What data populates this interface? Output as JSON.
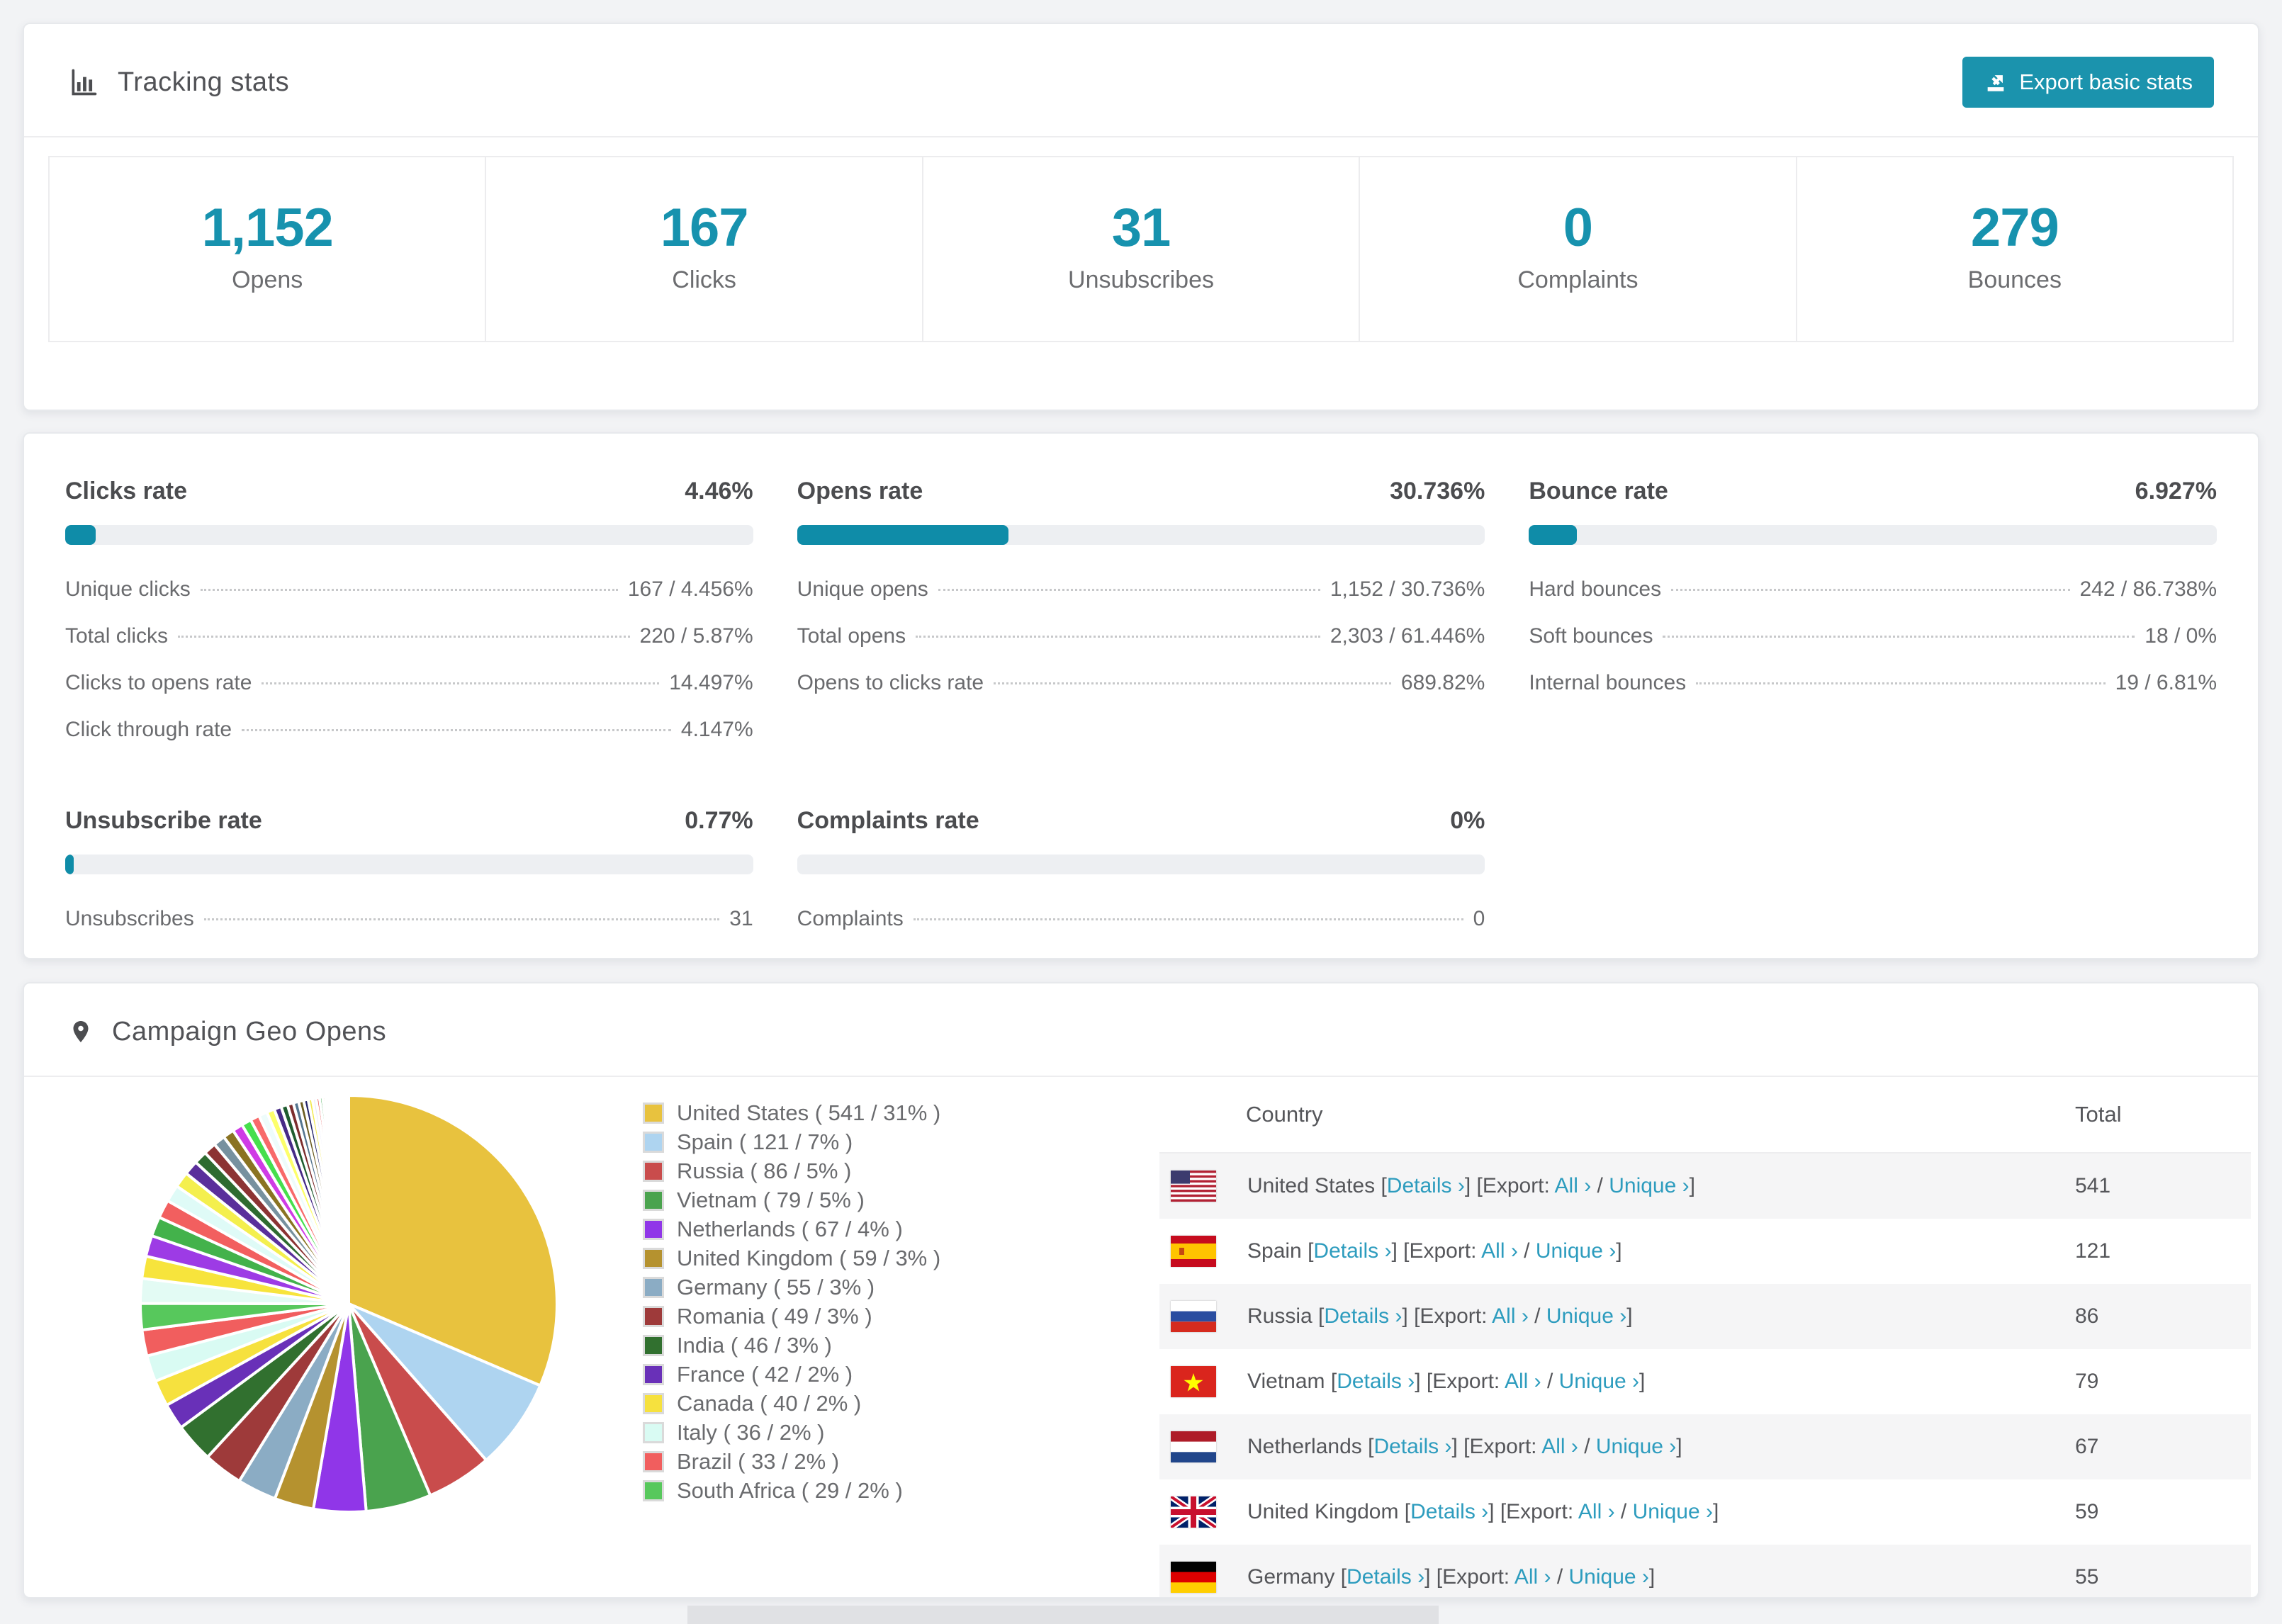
{
  "accent": "#1792ae",
  "tracking": {
    "title": "Tracking stats",
    "export_button": "Export basic stats",
    "stats": [
      {
        "value": "1,152",
        "label": "Opens"
      },
      {
        "value": "167",
        "label": "Clicks"
      },
      {
        "value": "31",
        "label": "Unsubscribes"
      },
      {
        "value": "0",
        "label": "Complaints"
      },
      {
        "value": "279",
        "label": "Bounces"
      }
    ]
  },
  "rates": [
    {
      "title": "Clicks rate",
      "value": "4.46%",
      "percent": 4.46,
      "rows": [
        {
          "label": "Unique clicks",
          "value": "167 / 4.456%"
        },
        {
          "label": "Total clicks",
          "value": "220 / 5.87%"
        },
        {
          "label": "Clicks to opens rate",
          "value": "14.497%"
        },
        {
          "label": "Click through rate",
          "value": "4.147%"
        }
      ]
    },
    {
      "title": "Opens rate",
      "value": "30.736%",
      "percent": 30.736,
      "rows": [
        {
          "label": "Unique opens",
          "value": "1,152 / 30.736%"
        },
        {
          "label": "Total opens",
          "value": "2,303 / 61.446%"
        },
        {
          "label": "Opens to clicks rate",
          "value": "689.82%"
        }
      ]
    },
    {
      "title": "Bounce rate",
      "value": "6.927%",
      "percent": 6.927,
      "rows": [
        {
          "label": "Hard bounces",
          "value": "242 / 86.738%"
        },
        {
          "label": "Soft bounces",
          "value": "18 / 0%"
        },
        {
          "label": "Internal bounces",
          "value": "19 / 6.81%"
        }
      ]
    },
    {
      "title": "Unsubscribe rate",
      "value": "0.77%",
      "percent": 0.77,
      "rows": [
        {
          "label": "Unsubscribes",
          "value": "31"
        }
      ]
    },
    {
      "title": "Complaints rate",
      "value": "0%",
      "percent": 0,
      "rows": [
        {
          "label": "Complaints",
          "value": "0"
        }
      ]
    }
  ],
  "geo": {
    "title": "Campaign Geo Opens",
    "chart_data": {
      "type": "pie",
      "title": "Campaign Geo Opens",
      "labels": [
        "United States",
        "Spain",
        "Russia",
        "Vietnam",
        "Netherlands",
        "United Kingdom",
        "Germany",
        "Romania",
        "India",
        "France",
        "Canada",
        "Italy",
        "Brazil",
        "South Africa"
      ],
      "values": [
        541,
        121,
        86,
        79,
        67,
        59,
        55,
        49,
        46,
        42,
        40,
        36,
        33,
        29
      ],
      "percents": [
        31,
        7,
        5,
        5,
        4,
        3,
        3,
        3,
        3,
        2,
        2,
        2,
        2,
        2
      ],
      "colors": [
        "#e8c23e",
        "#aed4f0",
        "#c94c4c",
        "#4aa34e",
        "#9036e8",
        "#b5922f",
        "#8bacc4",
        "#9e3a3a",
        "#31702f",
        "#6930b8",
        "#f6e13e",
        "#d9fbf3",
        "#f15e5e",
        "#57c85c"
      ],
      "legend_position": "right",
      "others": {
        "values": [
          1.9,
          1.7,
          1.6,
          1.5,
          1.4,
          1.3,
          1.2,
          1.1,
          1.0,
          0.95,
          0.9,
          0.85,
          0.8,
          0.75,
          0.7,
          0.65,
          0.6,
          0.55,
          0.5,
          0.46,
          0.42,
          0.38,
          0.35,
          0.32,
          0.29,
          0.26,
          0.24,
          0.22,
          0.2,
          0.18,
          0.16,
          0.14,
          0.13,
          0.12,
          0.11,
          0.1,
          0.09,
          0.08,
          0.07,
          0.06,
          0.05,
          0.05,
          0.04,
          0.04,
          0.03,
          0.03,
          0.02,
          0.02,
          0.02,
          0.01
        ],
        "colors": [
          "#e3fbf4",
          "#f7e43c",
          "#9d3be5",
          "#43b24b",
          "#f25f5f",
          "#dffbf7",
          "#f4ef4e",
          "#5a2f9b",
          "#2e6b30",
          "#8c3333",
          "#77919f",
          "#8a7322",
          "#cf3be5",
          "#46df4d",
          "#f86a6a",
          "#eefcfb",
          "#fdff6a",
          "#472a86",
          "#1f5c2f",
          "#7c2d2d",
          "#54758f",
          "#6b5c20",
          "#27276b",
          "#f2e94e",
          "#e8e8fb",
          "#e54545",
          "#3aa64b",
          "#c59b2d",
          "#a5cdf0",
          "#e04848",
          "#8a42e8",
          "#cfcffa",
          "#f0e040",
          "#44c06a",
          "#e86a9a",
          "#bfeef8",
          "#7a5fe0",
          "#2f8a5a",
          "#b0472f",
          "#6a8ab8",
          "#9a8a30",
          "#d06ae0",
          "#70e080",
          "#f09090",
          "#f0f8ff",
          "#e0e060",
          "#6040a0",
          "#407040",
          "#904040",
          "#8090a0"
        ]
      }
    },
    "legend": [
      {
        "text": "United States ( 541 / 31% )",
        "color": "#e8c23e"
      },
      {
        "text": "Spain ( 121 / 7% )",
        "color": "#aed4f0"
      },
      {
        "text": "Russia ( 86 / 5% )",
        "color": "#c94c4c"
      },
      {
        "text": "Vietnam ( 79 / 5% )",
        "color": "#4aa34e"
      },
      {
        "text": "Netherlands ( 67 / 4% )",
        "color": "#9036e8"
      },
      {
        "text": "United Kingdom ( 59 / 3% )",
        "color": "#b5922f"
      },
      {
        "text": "Germany ( 55 / 3% )",
        "color": "#8bacc4"
      },
      {
        "text": "Romania ( 49 / 3% )",
        "color": "#9e3a3a"
      },
      {
        "text": "India ( 46 / 3% )",
        "color": "#31702f"
      },
      {
        "text": "France ( 42 / 2% )",
        "color": "#6930b8"
      },
      {
        "text": "Canada ( 40 / 2% )",
        "color": "#f6e13e"
      },
      {
        "text": "Italy ( 36 / 2% )",
        "color": "#d9fbf3"
      },
      {
        "text": "Brazil ( 33 / 2% )",
        "color": "#f15e5e"
      },
      {
        "text": "South Africa ( 29 / 2% )",
        "color": "#57c85c"
      }
    ],
    "table": {
      "headers": [
        "Country",
        "Total"
      ],
      "link_labels": {
        "details": "Details ›",
        "export_prefix": "[Export:",
        "all": "All ›",
        "unique": "Unique ›",
        "slash": "/",
        "open": "[",
        "close": "]"
      },
      "rows": [
        {
          "flag": "us",
          "country": "United States",
          "total": "541"
        },
        {
          "flag": "es",
          "country": "Spain",
          "total": "121"
        },
        {
          "flag": "ru",
          "country": "Russia",
          "total": "86"
        },
        {
          "flag": "vn",
          "country": "Vietnam",
          "total": "79"
        },
        {
          "flag": "nl",
          "country": "Netherlands",
          "total": "67"
        },
        {
          "flag": "gb",
          "country": "United Kingdom",
          "total": "59"
        },
        {
          "flag": "de",
          "country": "Germany",
          "total": "55"
        }
      ]
    }
  }
}
